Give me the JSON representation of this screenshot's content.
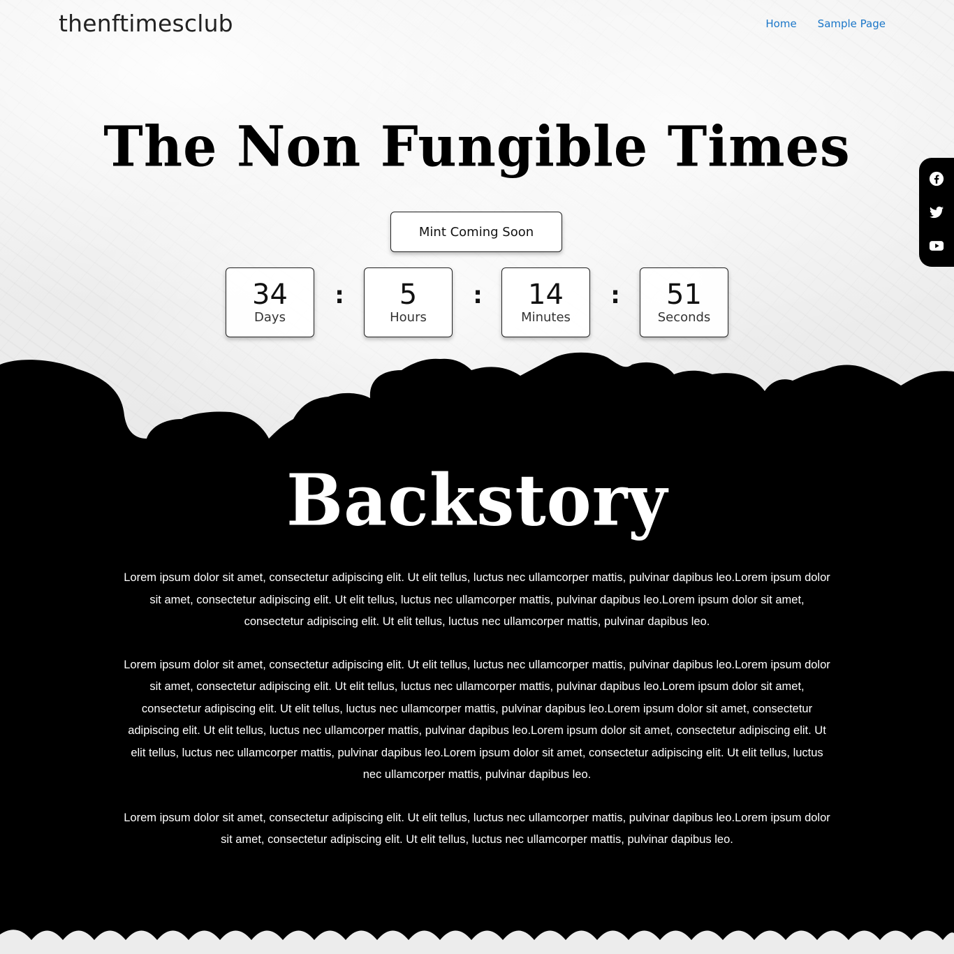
{
  "header": {
    "site_title": "thenftimesclub",
    "nav": [
      {
        "label": "Home"
      },
      {
        "label": "Sample Page"
      }
    ]
  },
  "hero": {
    "title": "The Non Fungible Times",
    "mint_button": "Mint Coming Soon"
  },
  "countdown": {
    "units": [
      {
        "value": "34",
        "label": "Days"
      },
      {
        "value": "5",
        "label": "Hours"
      },
      {
        "value": "14",
        "label": "Minutes"
      },
      {
        "value": "51",
        "label": "Seconds"
      }
    ],
    "separator": ":"
  },
  "social": {
    "icons": [
      "facebook-icon",
      "twitter-icon",
      "youtube-icon"
    ]
  },
  "backstory": {
    "title": "Backstory",
    "paragraphs": [
      "Lorem ipsum dolor sit amet, consectetur adipiscing elit. Ut elit tellus, luctus nec ullamcorper mattis, pulvinar dapibus leo.Lorem ipsum dolor sit amet, consectetur adipiscing elit. Ut elit tellus, luctus nec ullamcorper mattis, pulvinar dapibus leo.Lorem ipsum dolor sit amet, consectetur adipiscing elit. Ut elit tellus, luctus nec ullamcorper mattis, pulvinar dapibus leo.",
      "Lorem ipsum dolor sit amet, consectetur adipiscing elit. Ut elit tellus, luctus nec ullamcorper mattis, pulvinar dapibus leo.Lorem ipsum dolor sit amet, consectetur adipiscing elit. Ut elit tellus, luctus nec ullamcorper mattis, pulvinar dapibus leo.Lorem ipsum dolor sit amet, consectetur adipiscing elit. Ut elit tellus, luctus nec ullamcorper mattis, pulvinar dapibus leo.Lorem ipsum dolor sit amet, consectetur adipiscing elit. Ut elit tellus, luctus nec ullamcorper mattis, pulvinar dapibus leo.Lorem ipsum dolor sit amet, consectetur adipiscing elit. Ut elit tellus, luctus nec ullamcorper mattis, pulvinar dapibus leo.Lorem ipsum dolor sit amet, consectetur adipiscing elit. Ut elit tellus, luctus nec ullamcorper mattis, pulvinar dapibus leo.",
      "Lorem ipsum dolor sit amet, consectetur adipiscing elit. Ut elit tellus, luctus nec ullamcorper mattis, pulvinar dapibus leo.Lorem ipsum dolor sit amet, consectetur adipiscing elit. Ut elit tellus, luctus nec ullamcorper mattis, pulvinar dapibus leo."
    ]
  },
  "colors": {
    "nav_link": "#1a76c8",
    "dark_section": "#000000",
    "paper": "#eeeeee"
  }
}
